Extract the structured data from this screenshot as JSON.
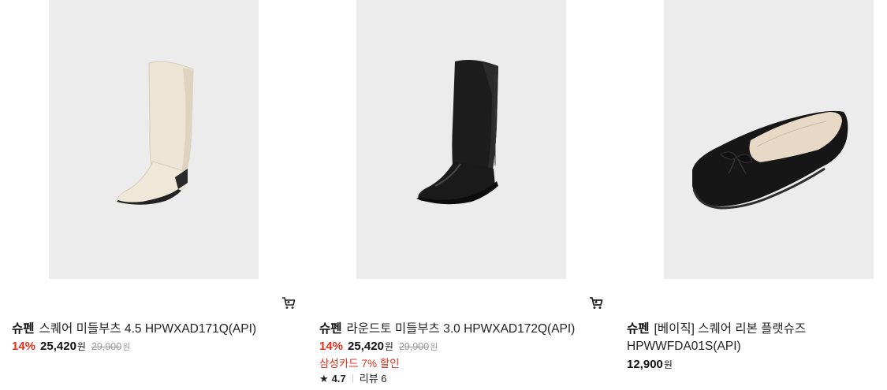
{
  "products": [
    {
      "brand": "슈펜",
      "name": "스퀘어 미들부츠 4.5 HPWXAD171Q(API)",
      "discount": "14%",
      "price": "25,420",
      "currency": "원",
      "original_price": "29,900",
      "original_currency": "원",
      "image": "ivory-mid-boot"
    },
    {
      "brand": "슈펜",
      "name": "라운드토 미들부츠 3.0 HPWXAD172Q(API)",
      "discount": "14%",
      "price": "25,420",
      "currency": "원",
      "original_price": "29,900",
      "original_currency": "원",
      "card_promo": "삼성카드 7% 할인",
      "rating": "4.7",
      "reviews": "리뷰 6",
      "image": "black-mid-boot"
    },
    {
      "brand": "슈펜",
      "name_line1": "[베이직] 스퀘어 리본 플랫슈즈",
      "name_line2": "HPWWFDA01S(API)",
      "price": "12,900",
      "currency": "원",
      "image": "black-ribbon-flat"
    }
  ],
  "icons": {
    "cart": "cart-icon",
    "star": "star-icon"
  },
  "colors": {
    "discount_red": "#e0301e",
    "image_bg": "#ececec",
    "strike_gray": "#999999"
  }
}
